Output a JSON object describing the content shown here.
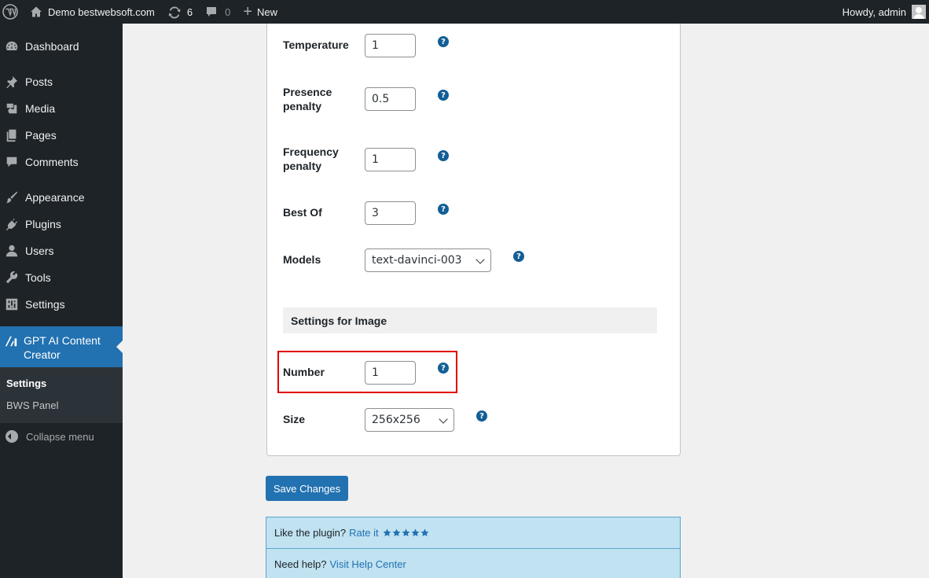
{
  "admin_bar": {
    "site_name": "Demo bestwebsoft.com",
    "updates_count": "6",
    "comments_count": "0",
    "new_label": "New",
    "greeting": "Howdy, admin"
  },
  "sidebar": {
    "items": [
      {
        "label": "Dashboard",
        "icon": "dashboard-icon"
      },
      {
        "label": "Posts",
        "icon": "pin-icon"
      },
      {
        "label": "Media",
        "icon": "media-icon"
      },
      {
        "label": "Pages",
        "icon": "pages-icon"
      },
      {
        "label": "Comments",
        "icon": "comment-icon"
      },
      {
        "label": "Appearance",
        "icon": "brush-icon"
      },
      {
        "label": "Plugins",
        "icon": "plugin-icon"
      },
      {
        "label": "Users",
        "icon": "user-icon"
      },
      {
        "label": "Tools",
        "icon": "wrench-icon"
      },
      {
        "label": "Settings",
        "icon": "sliders-icon"
      }
    ],
    "current": {
      "label": "GPT AI Content Creator",
      "icon": "gpt-plugin-icon"
    },
    "submenu": [
      "Settings",
      "BWS Panel"
    ],
    "collapse_label": "Collapse menu"
  },
  "form": {
    "temperature": {
      "label": "Temperature",
      "value": "1"
    },
    "presence_penalty": {
      "label": "Presence penalty",
      "value": "0.5"
    },
    "frequency_penalty": {
      "label": "Frequency penalty",
      "value": "1"
    },
    "best_of": {
      "label": "Best Of",
      "value": "3"
    },
    "models": {
      "label": "Models",
      "value": "text-davinci-003"
    },
    "image_section_title": "Settings for Image",
    "number": {
      "label": "Number",
      "value": "1"
    },
    "size": {
      "label": "Size",
      "value": "256x256"
    },
    "help_glyph": "?"
  },
  "save_label": "Save Changes",
  "notice": {
    "rate_text": "Like the plugin?",
    "rate_link": "Rate it",
    "rating_stars": 5,
    "help_text": "Need help?",
    "help_link": "Visit Help Center"
  },
  "colors": {
    "admin_dark": "#1d2327",
    "accent": "#2271b1",
    "highlight_border": "#e00000",
    "notice_bg": "#c0e2f1"
  }
}
